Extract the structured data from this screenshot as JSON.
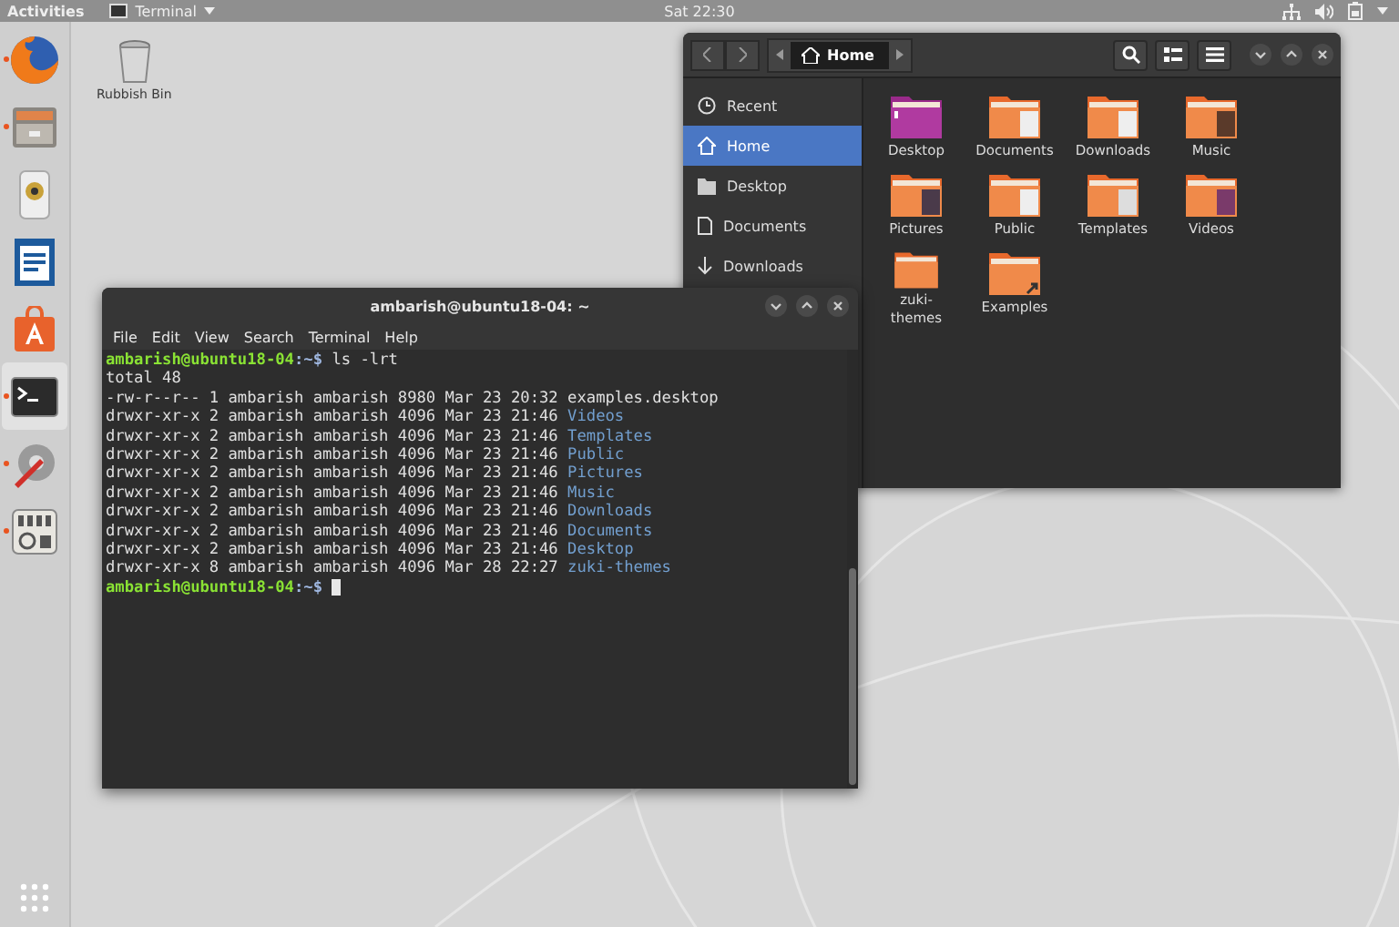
{
  "top_bar": {
    "activities": "Activities",
    "app_menu": "Terminal",
    "clock": "Sat 22:30"
  },
  "dock": [
    {
      "kind": "browser",
      "running": true,
      "selected": false
    },
    {
      "kind": "files",
      "running": true,
      "selected": false
    },
    {
      "kind": "music",
      "running": false,
      "selected": false
    },
    {
      "kind": "writer",
      "running": false,
      "selected": false
    },
    {
      "kind": "store",
      "running": false,
      "selected": false
    },
    {
      "kind": "terminal",
      "running": true,
      "selected": true
    },
    {
      "kind": "tools",
      "running": true,
      "selected": false
    },
    {
      "kind": "mixer",
      "running": true,
      "selected": false
    }
  ],
  "desktop_icons": [
    {
      "label": "Rubbish Bin"
    }
  ],
  "files": {
    "location": "Home",
    "sidebar": [
      {
        "kind": "recent",
        "label": "Recent",
        "selected": false
      },
      {
        "kind": "home",
        "label": "Home",
        "selected": true
      },
      {
        "kind": "folder",
        "label": "Desktop",
        "selected": false
      },
      {
        "kind": "document",
        "label": "Documents",
        "selected": false
      },
      {
        "kind": "download",
        "label": "Downloads",
        "selected": false
      }
    ],
    "folders": [
      {
        "kind": "desktop",
        "label": "Desktop"
      },
      {
        "kind": "documents",
        "label": "Documents"
      },
      {
        "kind": "downloads",
        "label": "Downloads"
      },
      {
        "kind": "music",
        "label": "Music"
      },
      {
        "kind": "pictures",
        "label": "Pictures"
      },
      {
        "kind": "public",
        "label": "Public"
      },
      {
        "kind": "templates",
        "label": "Templates"
      },
      {
        "kind": "videos",
        "label": "Videos"
      },
      {
        "kind": "plain",
        "label": "zuki-\nthemes"
      },
      {
        "kind": "link",
        "label": "Examples"
      }
    ]
  },
  "terminal": {
    "title": "ambarish@ubuntu18-04: ~",
    "menu": [
      "File",
      "Edit",
      "View",
      "Search",
      "Terminal",
      "Help"
    ],
    "lines": [
      {
        "kind": "prompt",
        "user_host": "ambarish@ubuntu18-04",
        "path": ":~$",
        "command": "ls -lrt"
      },
      {
        "kind": "text",
        "text": "total 48"
      },
      {
        "kind": "entry",
        "meta": "-rw-r--r-- 1 ambarish ambarish 8980 Mar 23 20:32",
        "name": "examples.desktop",
        "directory": false
      },
      {
        "kind": "entry",
        "meta": "drwxr-xr-x 2 ambarish ambarish 4096 Mar 23 21:46",
        "name": "Videos",
        "directory": true
      },
      {
        "kind": "entry",
        "meta": "drwxr-xr-x 2 ambarish ambarish 4096 Mar 23 21:46",
        "name": "Templates",
        "directory": true
      },
      {
        "kind": "entry",
        "meta": "drwxr-xr-x 2 ambarish ambarish 4096 Mar 23 21:46",
        "name": "Public",
        "directory": true
      },
      {
        "kind": "entry",
        "meta": "drwxr-xr-x 2 ambarish ambarish 4096 Mar 23 21:46",
        "name": "Pictures",
        "directory": true
      },
      {
        "kind": "entry",
        "meta": "drwxr-xr-x 2 ambarish ambarish 4096 Mar 23 21:46",
        "name": "Music",
        "directory": true
      },
      {
        "kind": "entry",
        "meta": "drwxr-xr-x 2 ambarish ambarish 4096 Mar 23 21:46",
        "name": "Downloads",
        "directory": true
      },
      {
        "kind": "entry",
        "meta": "drwxr-xr-x 2 ambarish ambarish 4096 Mar 23 21:46",
        "name": "Documents",
        "directory": true
      },
      {
        "kind": "entry",
        "meta": "drwxr-xr-x 2 ambarish ambarish 4096 Mar 23 21:46",
        "name": "Desktop",
        "directory": true
      },
      {
        "kind": "entry",
        "meta": "drwxr-xr-x 8 ambarish ambarish 4096 Mar 28 22:27",
        "name": "zuki-themes",
        "directory": true
      },
      {
        "kind": "prompt",
        "user_host": "ambarish@ubuntu18-04",
        "path": ":~$"
      }
    ]
  }
}
